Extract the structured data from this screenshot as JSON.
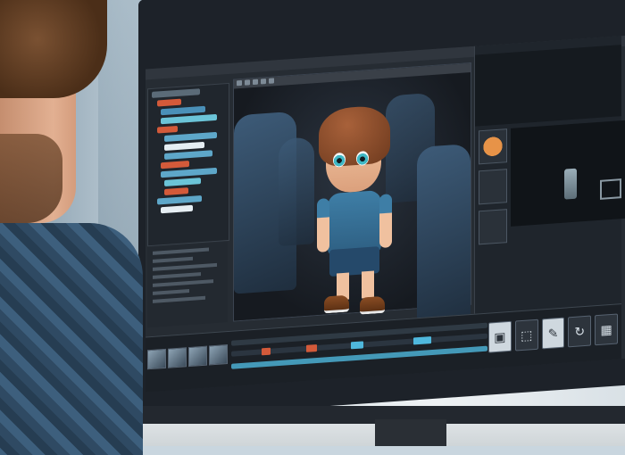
{
  "scene": {
    "subject": "",
    "colors": {
      "accent_blue": "#3e7ea6",
      "timeline_red": "#d35a3a",
      "timeline_cyan": "#4fb8dd",
      "ui_dark": "#1f252c"
    }
  },
  "editor": {
    "menubar_items": [
      "",
      "",
      "",
      "",
      "",
      ""
    ],
    "viewport_tools": [
      "move-icon",
      "rotate-icon",
      "scale-icon",
      "camera-icon",
      "light-icon"
    ],
    "tool_icons": [
      "select-icon",
      "crop-icon",
      "brush-icon",
      "rotate-icon",
      "frame-icon"
    ]
  }
}
